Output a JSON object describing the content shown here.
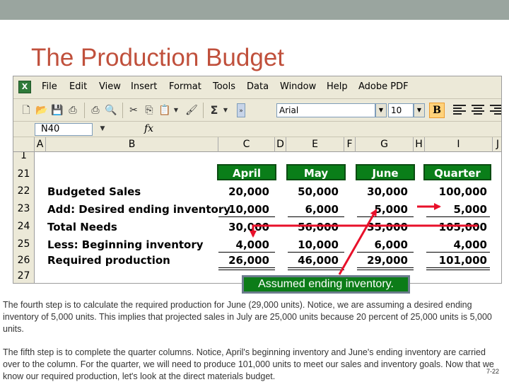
{
  "slide": {
    "title": "The Production Budget",
    "callout": "Assumed ending inventory.",
    "paragraph1": "The fourth step is to calculate the required production for June (29,000 units). Notice, we are assuming a desired ending inventory of 5,000 units. This implies that projected sales in July are 25,000 units because 20 percent of 25,000 units is 5,000 units.",
    "paragraph2": "The fifth step is to complete the quarter columns. Notice, April's beginning inventory and June's ending inventory are carried over to the column. For the quarter, we will need to produce 101,000 units to meet our sales and inventory goals. Now that we know our required production, let's look at the direct materials budget.",
    "page_number": "7-22",
    "colors": {
      "title": "#c0503c",
      "header_fill": "#0a7e19",
      "arrow": "#e8102a",
      "topbar": "#9aa59f"
    }
  },
  "excel": {
    "menu": [
      "File",
      "Edit",
      "View",
      "Insert",
      "Format",
      "Tools",
      "Data",
      "Window",
      "Help",
      "Adobe PDF"
    ],
    "font_name": "Arial",
    "font_size": "10",
    "bold_label": "B",
    "name_box": "N40",
    "fx_label": "fx",
    "sigma_icon": "Σ",
    "columns": [
      "A",
      "B",
      "C",
      "D",
      "E",
      "F",
      "G",
      "H",
      "I",
      "J"
    ],
    "rows": [
      "1",
      "21",
      "22",
      "23",
      "24",
      "25",
      "26",
      "27"
    ],
    "headers": [
      "April",
      "May",
      "June",
      "Quarter"
    ],
    "lines": [
      {
        "label": "Budgeted Sales",
        "values": [
          "20,000",
          "50,000",
          "30,000",
          "100,000"
        ]
      },
      {
        "label": "Add: Desired ending inventory",
        "values": [
          "10,000",
          "6,000",
          "5,000",
          "5,000"
        ]
      },
      {
        "label": "Total Needs",
        "values": [
          "30,000",
          "56,000",
          "35,000",
          "105,000"
        ]
      },
      {
        "label": "Less: Beginning inventory",
        "values": [
          "4,000",
          "10,000",
          "6,000",
          "4,000"
        ]
      },
      {
        "label": "Required production",
        "values": [
          "26,000",
          "46,000",
          "29,000",
          "101,000"
        ]
      }
    ]
  }
}
